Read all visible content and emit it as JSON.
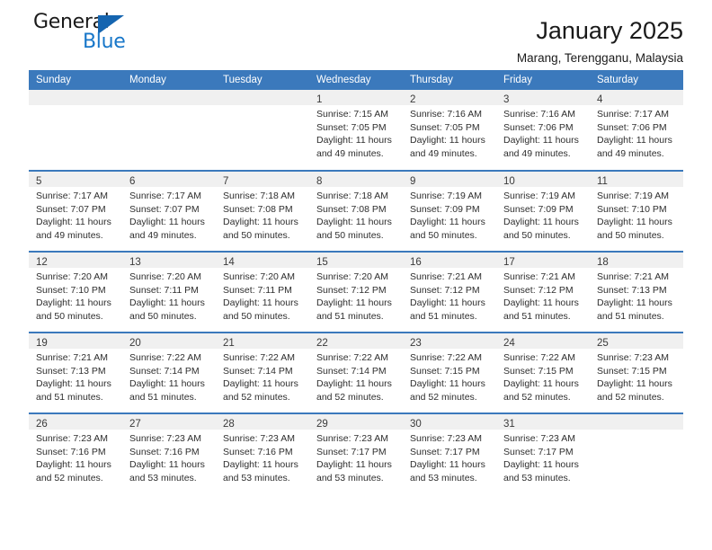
{
  "brand": {
    "name_part1": "General",
    "name_part2": "Blue",
    "triangle_color": "#1565b0",
    "blue_color": "#1877c9"
  },
  "header": {
    "title": "January 2025",
    "subtitle": "Marang, Terengganu, Malaysia"
  },
  "calendar": {
    "header_bg": "#3b79bc",
    "daynum_bg": "#f0f0f0",
    "day_names": [
      "Sunday",
      "Monday",
      "Tuesday",
      "Wednesday",
      "Thursday",
      "Friday",
      "Saturday"
    ],
    "weeks": [
      [
        {
          "day": "",
          "lines": []
        },
        {
          "day": "",
          "lines": []
        },
        {
          "day": "",
          "lines": []
        },
        {
          "day": "1",
          "lines": [
            "Sunrise: 7:15 AM",
            "Sunset: 7:05 PM",
            "Daylight: 11 hours",
            "and 49 minutes."
          ]
        },
        {
          "day": "2",
          "lines": [
            "Sunrise: 7:16 AM",
            "Sunset: 7:05 PM",
            "Daylight: 11 hours",
            "and 49 minutes."
          ]
        },
        {
          "day": "3",
          "lines": [
            "Sunrise: 7:16 AM",
            "Sunset: 7:06 PM",
            "Daylight: 11 hours",
            "and 49 minutes."
          ]
        },
        {
          "day": "4",
          "lines": [
            "Sunrise: 7:17 AM",
            "Sunset: 7:06 PM",
            "Daylight: 11 hours",
            "and 49 minutes."
          ]
        }
      ],
      [
        {
          "day": "5",
          "lines": [
            "Sunrise: 7:17 AM",
            "Sunset: 7:07 PM",
            "Daylight: 11 hours",
            "and 49 minutes."
          ]
        },
        {
          "day": "6",
          "lines": [
            "Sunrise: 7:17 AM",
            "Sunset: 7:07 PM",
            "Daylight: 11 hours",
            "and 49 minutes."
          ]
        },
        {
          "day": "7",
          "lines": [
            "Sunrise: 7:18 AM",
            "Sunset: 7:08 PM",
            "Daylight: 11 hours",
            "and 50 minutes."
          ]
        },
        {
          "day": "8",
          "lines": [
            "Sunrise: 7:18 AM",
            "Sunset: 7:08 PM",
            "Daylight: 11 hours",
            "and 50 minutes."
          ]
        },
        {
          "day": "9",
          "lines": [
            "Sunrise: 7:19 AM",
            "Sunset: 7:09 PM",
            "Daylight: 11 hours",
            "and 50 minutes."
          ]
        },
        {
          "day": "10",
          "lines": [
            "Sunrise: 7:19 AM",
            "Sunset: 7:09 PM",
            "Daylight: 11 hours",
            "and 50 minutes."
          ]
        },
        {
          "day": "11",
          "lines": [
            "Sunrise: 7:19 AM",
            "Sunset: 7:10 PM",
            "Daylight: 11 hours",
            "and 50 minutes."
          ]
        }
      ],
      [
        {
          "day": "12",
          "lines": [
            "Sunrise: 7:20 AM",
            "Sunset: 7:10 PM",
            "Daylight: 11 hours",
            "and 50 minutes."
          ]
        },
        {
          "day": "13",
          "lines": [
            "Sunrise: 7:20 AM",
            "Sunset: 7:11 PM",
            "Daylight: 11 hours",
            "and 50 minutes."
          ]
        },
        {
          "day": "14",
          "lines": [
            "Sunrise: 7:20 AM",
            "Sunset: 7:11 PM",
            "Daylight: 11 hours",
            "and 50 minutes."
          ]
        },
        {
          "day": "15",
          "lines": [
            "Sunrise: 7:20 AM",
            "Sunset: 7:12 PM",
            "Daylight: 11 hours",
            "and 51 minutes."
          ]
        },
        {
          "day": "16",
          "lines": [
            "Sunrise: 7:21 AM",
            "Sunset: 7:12 PM",
            "Daylight: 11 hours",
            "and 51 minutes."
          ]
        },
        {
          "day": "17",
          "lines": [
            "Sunrise: 7:21 AM",
            "Sunset: 7:12 PM",
            "Daylight: 11 hours",
            "and 51 minutes."
          ]
        },
        {
          "day": "18",
          "lines": [
            "Sunrise: 7:21 AM",
            "Sunset: 7:13 PM",
            "Daylight: 11 hours",
            "and 51 minutes."
          ]
        }
      ],
      [
        {
          "day": "19",
          "lines": [
            "Sunrise: 7:21 AM",
            "Sunset: 7:13 PM",
            "Daylight: 11 hours",
            "and 51 minutes."
          ]
        },
        {
          "day": "20",
          "lines": [
            "Sunrise: 7:22 AM",
            "Sunset: 7:14 PM",
            "Daylight: 11 hours",
            "and 51 minutes."
          ]
        },
        {
          "day": "21",
          "lines": [
            "Sunrise: 7:22 AM",
            "Sunset: 7:14 PM",
            "Daylight: 11 hours",
            "and 52 minutes."
          ]
        },
        {
          "day": "22",
          "lines": [
            "Sunrise: 7:22 AM",
            "Sunset: 7:14 PM",
            "Daylight: 11 hours",
            "and 52 minutes."
          ]
        },
        {
          "day": "23",
          "lines": [
            "Sunrise: 7:22 AM",
            "Sunset: 7:15 PM",
            "Daylight: 11 hours",
            "and 52 minutes."
          ]
        },
        {
          "day": "24",
          "lines": [
            "Sunrise: 7:22 AM",
            "Sunset: 7:15 PM",
            "Daylight: 11 hours",
            "and 52 minutes."
          ]
        },
        {
          "day": "25",
          "lines": [
            "Sunrise: 7:23 AM",
            "Sunset: 7:15 PM",
            "Daylight: 11 hours",
            "and 52 minutes."
          ]
        }
      ],
      [
        {
          "day": "26",
          "lines": [
            "Sunrise: 7:23 AM",
            "Sunset: 7:16 PM",
            "Daylight: 11 hours",
            "and 52 minutes."
          ]
        },
        {
          "day": "27",
          "lines": [
            "Sunrise: 7:23 AM",
            "Sunset: 7:16 PM",
            "Daylight: 11 hours",
            "and 53 minutes."
          ]
        },
        {
          "day": "28",
          "lines": [
            "Sunrise: 7:23 AM",
            "Sunset: 7:16 PM",
            "Daylight: 11 hours",
            "and 53 minutes."
          ]
        },
        {
          "day": "29",
          "lines": [
            "Sunrise: 7:23 AM",
            "Sunset: 7:17 PM",
            "Daylight: 11 hours",
            "and 53 minutes."
          ]
        },
        {
          "day": "30",
          "lines": [
            "Sunrise: 7:23 AM",
            "Sunset: 7:17 PM",
            "Daylight: 11 hours",
            "and 53 minutes."
          ]
        },
        {
          "day": "31",
          "lines": [
            "Sunrise: 7:23 AM",
            "Sunset: 7:17 PM",
            "Daylight: 11 hours",
            "and 53 minutes."
          ]
        },
        {
          "day": "",
          "lines": []
        }
      ]
    ]
  }
}
